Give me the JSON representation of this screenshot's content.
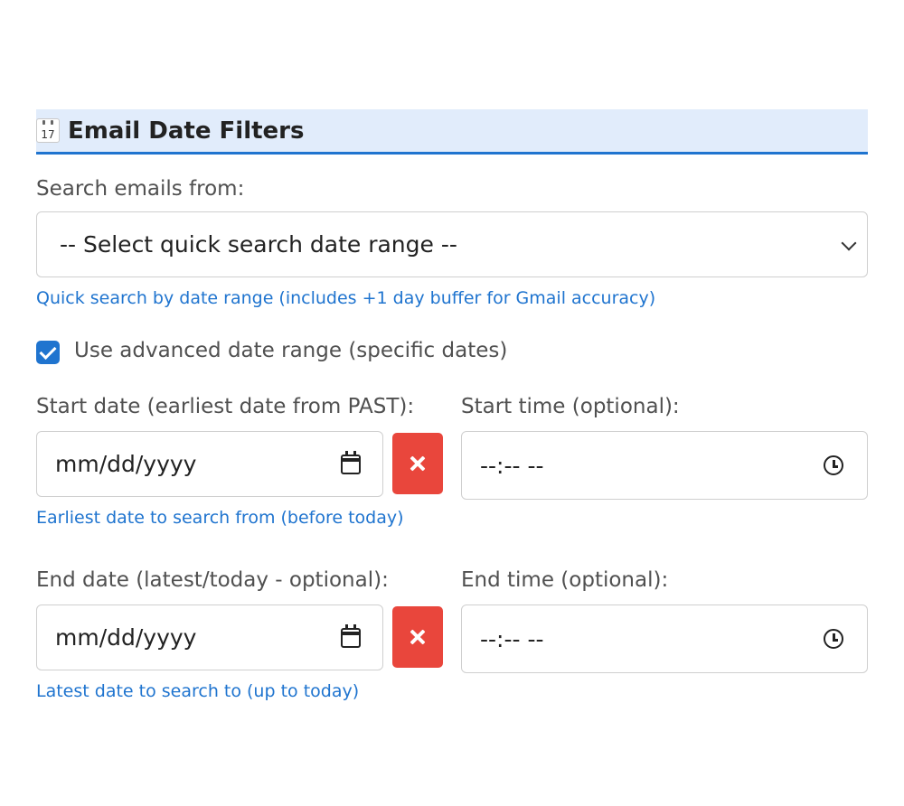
{
  "section": {
    "icon": "calendar-icon",
    "icon_day": "17",
    "title": "Email Date Filters",
    "accent_color": "#1f74cf",
    "header_bg": "#e1ecfb"
  },
  "quick_search": {
    "label": "Search emails from:",
    "selected": "-- Select quick search date range --",
    "hint": "Quick search by date range (includes +1 day buffer for Gmail accuracy)"
  },
  "advanced": {
    "checkbox_label": "Use advanced date range (specific dates)",
    "checked": true
  },
  "start": {
    "date_label": "Start date (earliest date from PAST):",
    "date_value": "mm/dd/yyyy",
    "time_label": "Start time (optional):",
    "time_value": "--:-- --",
    "hint": "Earliest date to search from (before today)"
  },
  "end": {
    "date_label": "End date (latest/today - optional):",
    "date_value": "mm/dd/yyyy",
    "time_label": "End time (optional):",
    "time_value": "--:-- --",
    "hint": "Latest date to search to (up to today)"
  },
  "colors": {
    "clear_button": "#e9463c",
    "hint_text": "#1f74cf"
  }
}
